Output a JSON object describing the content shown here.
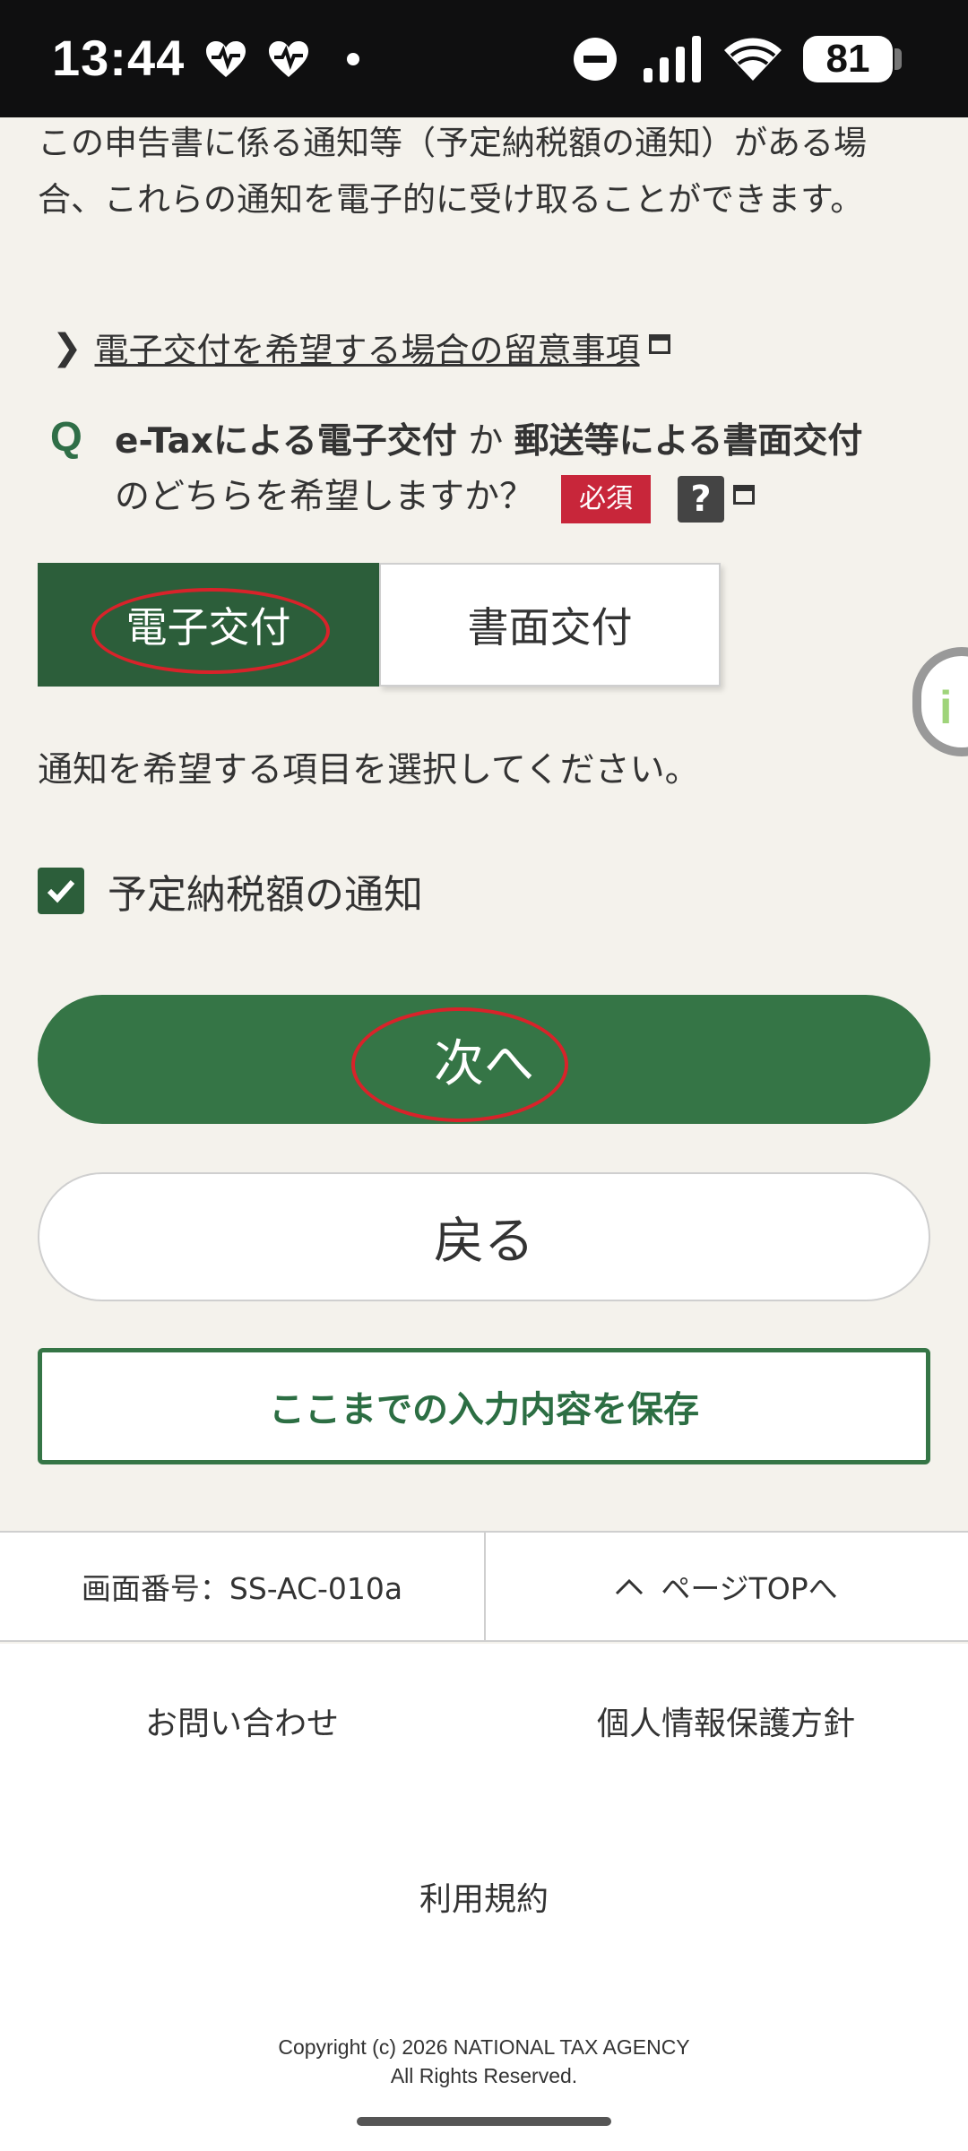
{
  "status_bar": {
    "time": "13:44",
    "battery": "81",
    "icons": [
      "heart-rate-icon",
      "heart-rate-icon",
      "dot-icon",
      "do-not-disturb-icon",
      "signal-icon",
      "wifi-icon",
      "battery-icon"
    ]
  },
  "intro_text": "この申告書に係る通知等（予定納税額の通知）がある場合、これらの通知を電子的に受け取ることができます。",
  "notice_link": "電子交付を希望する場合の留意事項",
  "question": {
    "mark": "Q",
    "part1": "e-Taxによる電子交付",
    "part2": " か ",
    "part3": "郵送等による書面交付",
    "part4": "のどちらを希望しますか？",
    "required": "必須",
    "help": "?"
  },
  "toggle": {
    "selected": "電子交付",
    "option_electronic": "電子交付",
    "option_paper": "書面交付"
  },
  "instruction": "通知を希望する項目を選択してください。",
  "checkbox": {
    "label": "予定納税額の通知",
    "checked": true
  },
  "buttons": {
    "next": "次へ",
    "back": "戻る",
    "save": "ここまでの入力内容を保存"
  },
  "footer": {
    "screen_number": "画面番号：SS-AC-010a",
    "page_top": "ページTOPへ",
    "contact": "お問い合わせ",
    "privacy": "個人情報保護方針",
    "terms": "利用規約",
    "copyright_line1": "Copyright (c) 2026 NATIONAL TAX AGENCY",
    "copyright_line2": "All Rights Reserved."
  },
  "colors": {
    "primary_green": "#357546",
    "selected_green": "#2c5e3a",
    "required_red": "#c8263a",
    "annotation_red": "#d8232a",
    "background": "#f4f2ec"
  }
}
